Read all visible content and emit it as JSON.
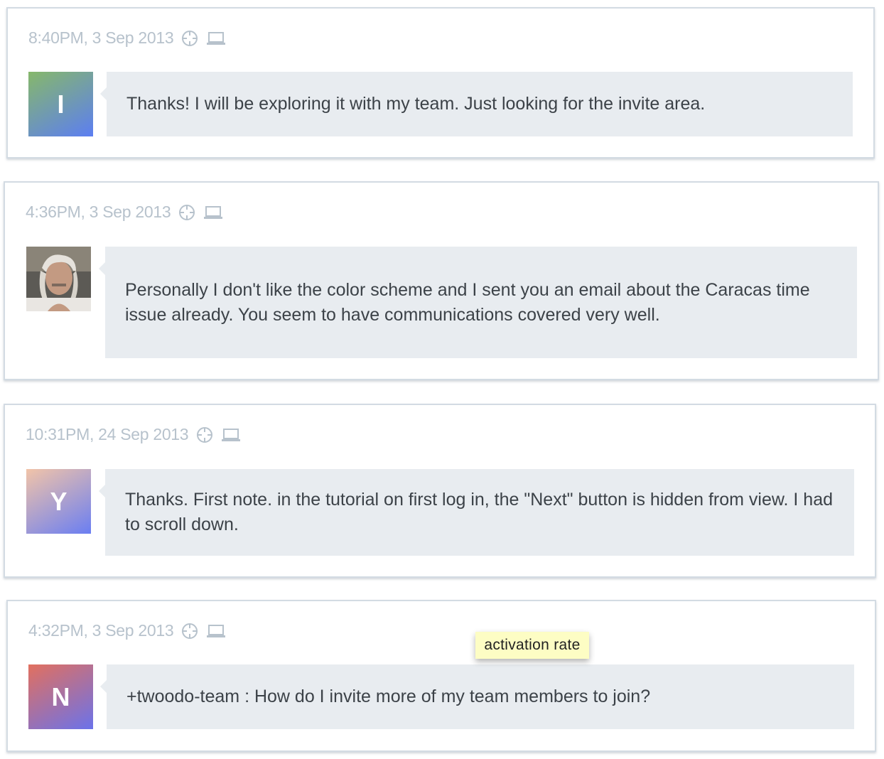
{
  "messages": [
    {
      "timestamp": "8:40PM, 3 Sep 2013",
      "avatar_letter": "I",
      "avatar_colors": [
        "#86b86a",
        "#5c7ef2"
      ],
      "text": "Thanks! I will be exploring it with my team. Just looking for the invite area.",
      "icons": [
        "crosshair-icon",
        "laptop-icon"
      ]
    },
    {
      "timestamp": "4:36PM, 3 Sep 2013",
      "avatar_letter": "",
      "avatar_is_photo": true,
      "text": "Personally I don't like the color scheme and I sent you an email about the Caracas time issue already. You seem to have communications covered very well.",
      "icons": [
        "crosshair-icon",
        "laptop-icon"
      ]
    },
    {
      "timestamp": "10:31PM, 24 Sep 2013",
      "avatar_letter": "Y",
      "avatar_colors": [
        "#f2c4a8",
        "#6a7ef2"
      ],
      "text": "Thanks. First note. in the tutorial on first log in, the \"Next\" button is hidden from view. I had to scroll down.",
      "icons": [
        "crosshair-icon",
        "laptop-icon"
      ]
    },
    {
      "timestamp": "4:32PM, 3 Sep 2013",
      "avatar_letter": "N",
      "avatar_colors": [
        "#e2705e",
        "#6b72ea"
      ],
      "text": "+twoodo-team : How do I invite more of my team members to join?",
      "icons": [
        "crosshair-icon",
        "laptop-icon"
      ]
    }
  ],
  "tooltip": {
    "text": "activation rate"
  },
  "colors": {
    "bubble_bg": "#e8ecf0",
    "card_border": "#d3dbe3",
    "timestamp": "#b7c2cc",
    "tooltip_bg": "#fdfdc4"
  }
}
